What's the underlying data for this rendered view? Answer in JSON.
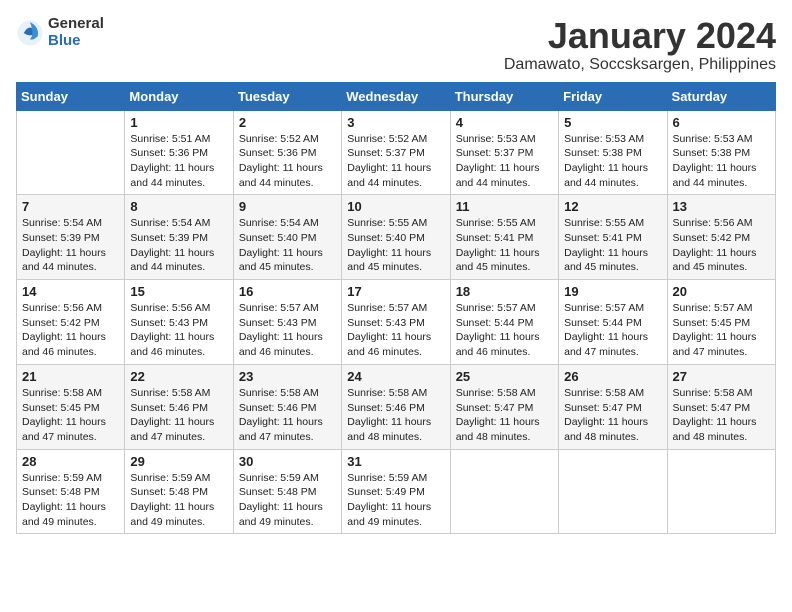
{
  "logo": {
    "general": "General",
    "blue": "Blue"
  },
  "title": "January 2024",
  "subtitle": "Damawato, Soccsksargen, Philippines",
  "days_of_week": [
    "Sunday",
    "Monday",
    "Tuesday",
    "Wednesday",
    "Thursday",
    "Friday",
    "Saturday"
  ],
  "weeks": [
    [
      {
        "day": "",
        "content": ""
      },
      {
        "day": "1",
        "content": "Sunrise: 5:51 AM\nSunset: 5:36 PM\nDaylight: 11 hours\nand 44 minutes."
      },
      {
        "day": "2",
        "content": "Sunrise: 5:52 AM\nSunset: 5:36 PM\nDaylight: 11 hours\nand 44 minutes."
      },
      {
        "day": "3",
        "content": "Sunrise: 5:52 AM\nSunset: 5:37 PM\nDaylight: 11 hours\nand 44 minutes."
      },
      {
        "day": "4",
        "content": "Sunrise: 5:53 AM\nSunset: 5:37 PM\nDaylight: 11 hours\nand 44 minutes."
      },
      {
        "day": "5",
        "content": "Sunrise: 5:53 AM\nSunset: 5:38 PM\nDaylight: 11 hours\nand 44 minutes."
      },
      {
        "day": "6",
        "content": "Sunrise: 5:53 AM\nSunset: 5:38 PM\nDaylight: 11 hours\nand 44 minutes."
      }
    ],
    [
      {
        "day": "7",
        "content": "Sunrise: 5:54 AM\nSunset: 5:39 PM\nDaylight: 11 hours\nand 44 minutes."
      },
      {
        "day": "8",
        "content": "Sunrise: 5:54 AM\nSunset: 5:39 PM\nDaylight: 11 hours\nand 44 minutes."
      },
      {
        "day": "9",
        "content": "Sunrise: 5:54 AM\nSunset: 5:40 PM\nDaylight: 11 hours\nand 45 minutes."
      },
      {
        "day": "10",
        "content": "Sunrise: 5:55 AM\nSunset: 5:40 PM\nDaylight: 11 hours\nand 45 minutes."
      },
      {
        "day": "11",
        "content": "Sunrise: 5:55 AM\nSunset: 5:41 PM\nDaylight: 11 hours\nand 45 minutes."
      },
      {
        "day": "12",
        "content": "Sunrise: 5:55 AM\nSunset: 5:41 PM\nDaylight: 11 hours\nand 45 minutes."
      },
      {
        "day": "13",
        "content": "Sunrise: 5:56 AM\nSunset: 5:42 PM\nDaylight: 11 hours\nand 45 minutes."
      }
    ],
    [
      {
        "day": "14",
        "content": "Sunrise: 5:56 AM\nSunset: 5:42 PM\nDaylight: 11 hours\nand 46 minutes."
      },
      {
        "day": "15",
        "content": "Sunrise: 5:56 AM\nSunset: 5:43 PM\nDaylight: 11 hours\nand 46 minutes."
      },
      {
        "day": "16",
        "content": "Sunrise: 5:57 AM\nSunset: 5:43 PM\nDaylight: 11 hours\nand 46 minutes."
      },
      {
        "day": "17",
        "content": "Sunrise: 5:57 AM\nSunset: 5:43 PM\nDaylight: 11 hours\nand 46 minutes."
      },
      {
        "day": "18",
        "content": "Sunrise: 5:57 AM\nSunset: 5:44 PM\nDaylight: 11 hours\nand 46 minutes."
      },
      {
        "day": "19",
        "content": "Sunrise: 5:57 AM\nSunset: 5:44 PM\nDaylight: 11 hours\nand 47 minutes."
      },
      {
        "day": "20",
        "content": "Sunrise: 5:57 AM\nSunset: 5:45 PM\nDaylight: 11 hours\nand 47 minutes."
      }
    ],
    [
      {
        "day": "21",
        "content": "Sunrise: 5:58 AM\nSunset: 5:45 PM\nDaylight: 11 hours\nand 47 minutes."
      },
      {
        "day": "22",
        "content": "Sunrise: 5:58 AM\nSunset: 5:46 PM\nDaylight: 11 hours\nand 47 minutes."
      },
      {
        "day": "23",
        "content": "Sunrise: 5:58 AM\nSunset: 5:46 PM\nDaylight: 11 hours\nand 47 minutes."
      },
      {
        "day": "24",
        "content": "Sunrise: 5:58 AM\nSunset: 5:46 PM\nDaylight: 11 hours\nand 48 minutes."
      },
      {
        "day": "25",
        "content": "Sunrise: 5:58 AM\nSunset: 5:47 PM\nDaylight: 11 hours\nand 48 minutes."
      },
      {
        "day": "26",
        "content": "Sunrise: 5:58 AM\nSunset: 5:47 PM\nDaylight: 11 hours\nand 48 minutes."
      },
      {
        "day": "27",
        "content": "Sunrise: 5:58 AM\nSunset: 5:47 PM\nDaylight: 11 hours\nand 48 minutes."
      }
    ],
    [
      {
        "day": "28",
        "content": "Sunrise: 5:59 AM\nSunset: 5:48 PM\nDaylight: 11 hours\nand 49 minutes."
      },
      {
        "day": "29",
        "content": "Sunrise: 5:59 AM\nSunset: 5:48 PM\nDaylight: 11 hours\nand 49 minutes."
      },
      {
        "day": "30",
        "content": "Sunrise: 5:59 AM\nSunset: 5:48 PM\nDaylight: 11 hours\nand 49 minutes."
      },
      {
        "day": "31",
        "content": "Sunrise: 5:59 AM\nSunset: 5:49 PM\nDaylight: 11 hours\nand 49 minutes."
      },
      {
        "day": "",
        "content": ""
      },
      {
        "day": "",
        "content": ""
      },
      {
        "day": "",
        "content": ""
      }
    ]
  ]
}
